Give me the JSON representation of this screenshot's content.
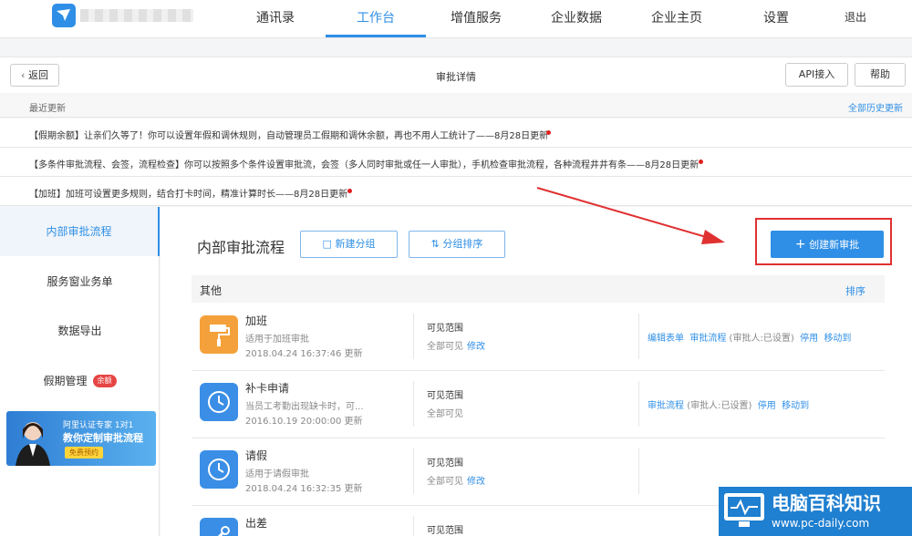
{
  "nav": {
    "items": [
      {
        "label": "通讯录",
        "active": false
      },
      {
        "label": "工作台",
        "active": true
      },
      {
        "label": "增值服务",
        "active": false
      },
      {
        "label": "企业数据",
        "active": false
      },
      {
        "label": "企业主页",
        "active": false
      },
      {
        "label": "设置",
        "active": false
      }
    ],
    "logout": "退出",
    "accent_color": "#2f8fe6"
  },
  "header": {
    "back_label": "返回",
    "title": "审批详情",
    "api_label": "API接入",
    "help_label": "帮助"
  },
  "updates": {
    "heading": "最近更新",
    "history_link": "全部历史更新",
    "items": [
      "【假期余额】让亲们久等了！你可以设置年假和调休规则，自动管理员工假期和调休余额，再也不用人工统计了——8月28日更新",
      "【多条件审批流程、会签，流程检查】你可以按照多个条件设置审批流，会签（多人同时审批或任一人审批），手机检查审批流程，各种流程井井有条——8月28日更新",
      "【加班】加班可设置更多规则，结合打卡时间，精准计算时长——8月28日更新"
    ]
  },
  "sidebar": {
    "items": [
      {
        "label": "内部审批流程",
        "active": true
      },
      {
        "label": "服务窗业务单",
        "active": false
      },
      {
        "label": "数据导出",
        "active": false
      },
      {
        "label": "假期管理",
        "active": false,
        "badge": "余额"
      }
    ],
    "banner": {
      "line1": "阿里认证专家 1对1",
      "line2": "教你定制审批流程",
      "cta": "免费预约"
    }
  },
  "main": {
    "title": "内部审批流程",
    "new_group": "新建分组",
    "sort_group": "分组排序",
    "create": "创建新审批",
    "group": {
      "name": "其他",
      "sort": "排序"
    },
    "rows": [
      {
        "name": "加班",
        "desc": "适用于加班审批",
        "time": "2018.04.24 16:37:46 更新",
        "icon": "paint-roller-icon",
        "icon_color": "#f5a13b",
        "visibility_label": "可见范围",
        "visibility_value": "全部可见",
        "modify": "修改",
        "actions": {
          "edit_form": "编辑表单",
          "flow": "审批流程",
          "flow_status": "(审批人:已设置)",
          "disable": "停用",
          "move": "移动到"
        }
      },
      {
        "name": "补卡申请",
        "desc": "当员工考勤出现缺卡时，可...",
        "time": "2016.10.19 20:00:00 更新",
        "icon": "clock-icon",
        "icon_color": "#3a8ee6",
        "visibility_label": "可见范围",
        "visibility_value": "全部可见",
        "modify": "",
        "actions": {
          "edit_form": "",
          "flow": "审批流程",
          "flow_status": "(审批人:已设置)",
          "disable": "停用",
          "move": "移动到"
        }
      },
      {
        "name": "请假",
        "desc": "适用于请假审批",
        "time": "2018.04.24 16:32:35 更新",
        "icon": "clock-icon",
        "icon_color": "#3a8ee6",
        "visibility_label": "可见范围",
        "visibility_value": "全部可见",
        "modify": "修改",
        "actions": {
          "edit_form": "",
          "flow": "",
          "flow_status": "",
          "disable": "",
          "move": ""
        }
      },
      {
        "name": "出差",
        "desc": "",
        "time": "",
        "icon": "tools-icon",
        "icon_color": "#3a8ee6",
        "visibility_label": "可见范围",
        "visibility_value": "",
        "modify": "",
        "actions": {
          "edit_form": "",
          "flow": "",
          "flow_status": "",
          "disable": "",
          "move": ""
        }
      }
    ]
  },
  "watermark": {
    "title": "电脑百科知识",
    "url": "www.pc-daily.com"
  }
}
